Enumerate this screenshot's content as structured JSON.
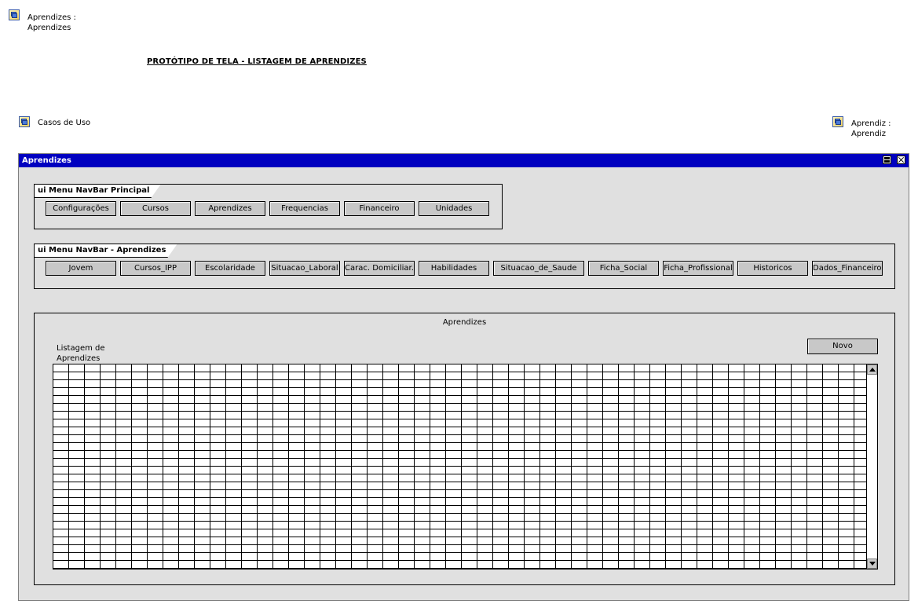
{
  "links": {
    "top_left": {
      "line1": "Aprendizes :",
      "line2": "Aprendizes"
    },
    "use_cases": {
      "label": "Casos de Uso"
    },
    "top_right": {
      "line1": "Aprendiz :",
      "line2": "Aprendiz"
    }
  },
  "page_title": "PROTÓTIPO DE TELA - LISTAGEM DE APRENDIZES",
  "window": {
    "title": "Aprendizes",
    "nav_principal": {
      "title": "ui Menu NavBar Principal",
      "buttons": [
        "Configurações",
        "Cursos",
        "Aprendizes",
        "Frequencias",
        "Financeiro",
        "Unidades"
      ]
    },
    "nav_aprendizes": {
      "title": "ui Menu NavBar - Aprendizes",
      "buttons": [
        "Jovem",
        "Cursos_IPP",
        "Escolaridade",
        "Situacao_Laboral",
        "Carac. Domiciliar.",
        "Habilidades",
        "Situacao_de_Saude",
        "Ficha_Social",
        "Ficha_Profissional",
        "Historicos",
        "Dados_Financeiros"
      ]
    },
    "list_panel": {
      "title": "Aprendizes",
      "list_label_line1": "Listagem de",
      "list_label_line2": "Aprendizes",
      "new_button": "Novo"
    }
  },
  "icons": {
    "link": "diagram-link-icon",
    "maximize": "maximize-icon",
    "close": "close-icon",
    "scroll_up": "arrow-up-icon",
    "scroll_down": "arrow-down-icon"
  },
  "colors": {
    "titlebar": "#0000c0",
    "window_bg": "#e0e0e0",
    "button_bg": "#c8c8c8"
  }
}
